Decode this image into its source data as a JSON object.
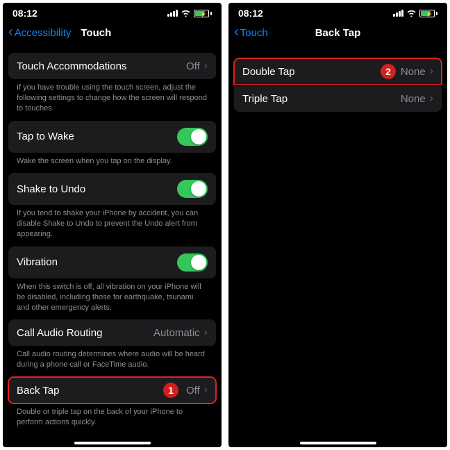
{
  "left": {
    "time": "08:12",
    "back": "Accessibility",
    "title": "Touch",
    "rows": {
      "accom": {
        "label": "Touch Accommodations",
        "value": "Off"
      },
      "accom_footer": "If you have trouble using the touch screen, adjust the following settings to change how the screen will respond to touches.",
      "tapwake": {
        "label": "Tap to Wake"
      },
      "tapwake_footer": "Wake the screen when you tap on the display.",
      "shake": {
        "label": "Shake to Undo"
      },
      "shake_footer": "If you tend to shake your iPhone by accident, you can disable Shake to Undo to prevent the Undo alert from appearing.",
      "vibration": {
        "label": "Vibration"
      },
      "vibration_footer": "When this switch is off, all vibration on your iPhone will be disabled, including those for earthquake, tsunami and other emergency alerts.",
      "audio": {
        "label": "Call Audio Routing",
        "value": "Automatic"
      },
      "audio_footer": "Call audio routing determines where audio will be heard during a phone call or FaceTime audio.",
      "backtap": {
        "label": "Back Tap",
        "value": "Off"
      },
      "backtap_footer": "Double or triple tap on the back of your iPhone to perform actions quickly."
    },
    "badge": "1"
  },
  "right": {
    "time": "08:12",
    "back": "Touch",
    "title": "Back Tap",
    "rows": {
      "double": {
        "label": "Double Tap",
        "value": "None"
      },
      "triple": {
        "label": "Triple Tap",
        "value": "None"
      }
    },
    "badge": "2"
  }
}
